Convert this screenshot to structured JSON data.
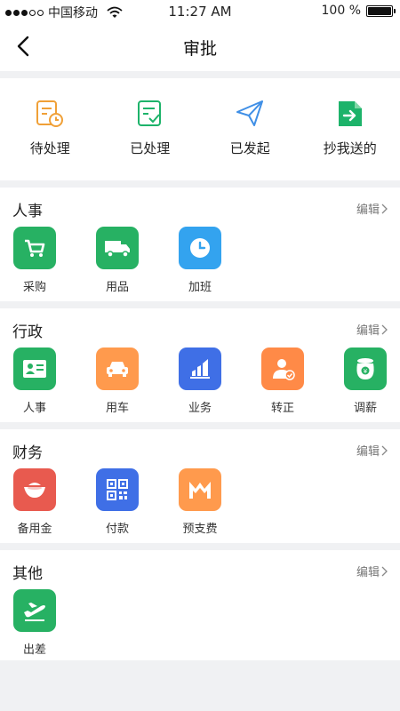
{
  "status_bar": {
    "carrier": "中国移动",
    "time": "11:27 AM",
    "battery": "100 %",
    "battery_level": 1.0
  },
  "nav": {
    "title": "审批"
  },
  "top_actions": [
    {
      "label": "待处理",
      "icon": "pending-doc-clock-icon",
      "color": "#f0a037"
    },
    {
      "label": "已处理",
      "icon": "processed-doc-check-icon",
      "color": "#1db36a"
    },
    {
      "label": "已发起",
      "icon": "paper-plane-icon",
      "color": "#3f8fe6"
    },
    {
      "label": "抄我送的",
      "icon": "cc-doc-arrow-icon",
      "color": "#1db36a"
    }
  ],
  "sections": [
    {
      "title": "人事",
      "edit_label": "编辑",
      "items": [
        {
          "label": "采购",
          "icon": "shopping-cart-icon",
          "color": "#27b163"
        },
        {
          "label": "用品",
          "icon": "truck-icon",
          "color": "#27b163"
        },
        {
          "label": "加班",
          "icon": "clock-icon",
          "color": "#33a3ef"
        }
      ]
    },
    {
      "title": "行政",
      "edit_label": "编辑",
      "items": [
        {
          "label": "人事",
          "icon": "id-card-icon",
          "color": "#27b163"
        },
        {
          "label": "用车",
          "icon": "car-icon",
          "color": "#ff9a4d"
        },
        {
          "label": "业务",
          "icon": "bar-chart-icon",
          "color": "#3f6fe6"
        },
        {
          "label": "转正",
          "icon": "user-check-icon",
          "color": "#ff8a47"
        },
        {
          "label": "调薪",
          "icon": "money-jar-icon",
          "color": "#27b163"
        }
      ]
    },
    {
      "title": "财务",
      "edit_label": "编辑",
      "items": [
        {
          "label": "备用金",
          "icon": "gold-ingot-icon",
          "color": "#e85a4f"
        },
        {
          "label": "付款",
          "icon": "qr-code-icon",
          "color": "#3f6fe6"
        },
        {
          "label": "预支费",
          "icon": "advance-chart-icon",
          "color": "#ff9a4d"
        }
      ]
    },
    {
      "title": "其他",
      "edit_label": "编辑",
      "items": [
        {
          "label": "出差",
          "icon": "airplane-icon",
          "color": "#27b163"
        }
      ]
    }
  ]
}
